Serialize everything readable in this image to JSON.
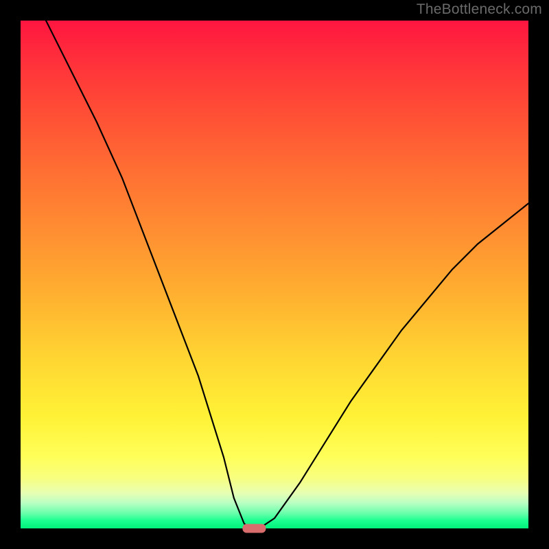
{
  "watermark": "TheBottleneck.com",
  "colors": {
    "background": "#000000",
    "gradient_top": "#ff1540",
    "gradient_mid": "#ffd432",
    "gradient_bottom": "#00f07a",
    "curve": "#000000",
    "trough_marker": "#d96d6d"
  },
  "chart_data": {
    "type": "line",
    "title": "",
    "xlabel": "",
    "ylabel": "",
    "xlim": [
      0,
      100
    ],
    "ylim": [
      0,
      100
    ],
    "series": [
      {
        "name": "bottleneck-curve",
        "x": [
          5,
          10,
          15,
          20,
          25,
          30,
          35,
          40,
          42,
          44,
          45,
          47,
          50,
          55,
          60,
          65,
          70,
          75,
          80,
          85,
          90,
          95,
          100
        ],
        "y": [
          100,
          90,
          80,
          69,
          56,
          43,
          30,
          14,
          6,
          1,
          0,
          0,
          2,
          9,
          17,
          25,
          32,
          39,
          45,
          51,
          56,
          60,
          64
        ]
      }
    ],
    "annotations": [
      {
        "name": "optimal-marker",
        "x": 46,
        "y": 0,
        "shape": "pill",
        "color": "#d96d6d"
      }
    ]
  }
}
